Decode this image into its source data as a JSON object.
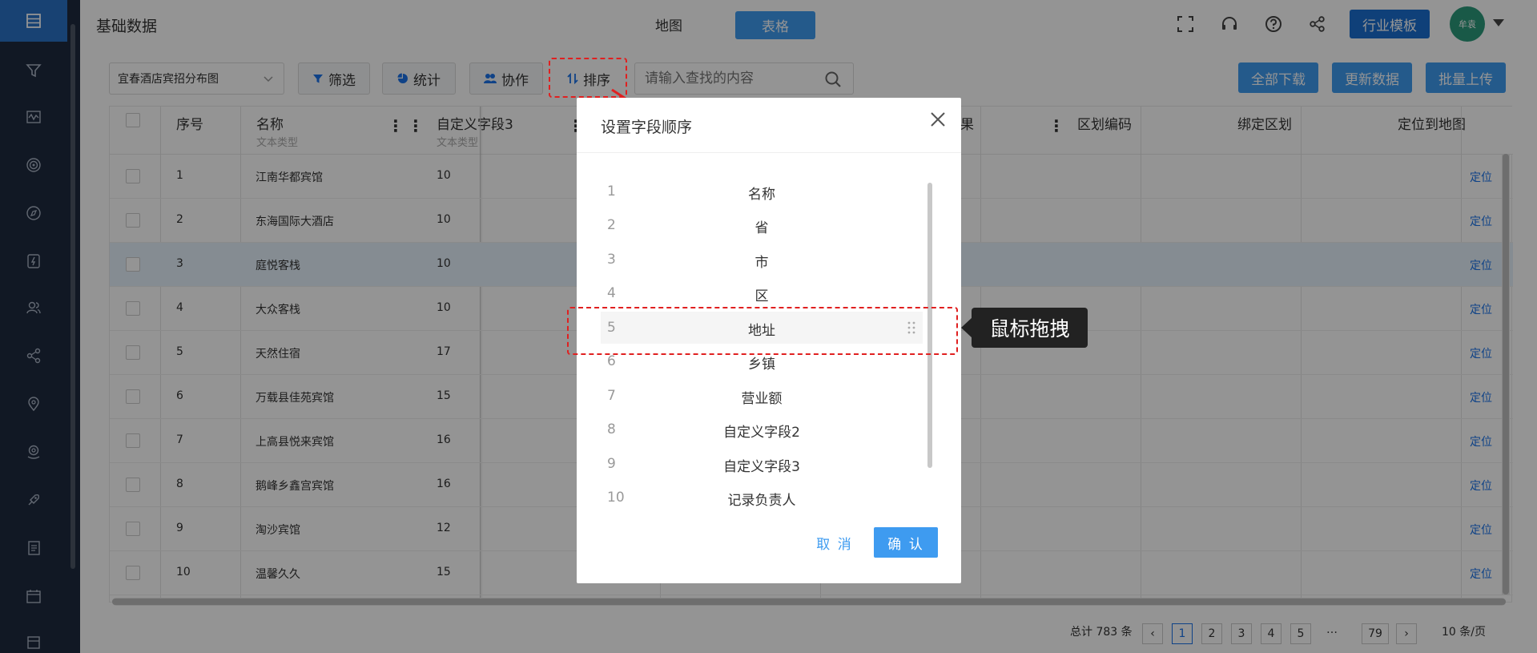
{
  "header": {
    "page_title": "基础数据",
    "view_map": "地图",
    "view_table": "表格",
    "template_button": "行业模板",
    "avatar_text": "牟袁"
  },
  "toolbar": {
    "map_select": "宜春酒店宾招分布图",
    "filter": "筛选",
    "stats": "统计",
    "collab": "协作",
    "sort": "排序",
    "search_placeholder": "请输入查找的内容",
    "download_all": "全部下载",
    "update_data": "更新数据",
    "batch_upload": "批量上传"
  },
  "table": {
    "columns": {
      "index": "序号",
      "name": "名称",
      "name_type": "文本类型",
      "custom3": "自定义字段3",
      "custom3_type": "文本类型",
      "result_partial": "果",
      "region_code": "区划编码",
      "bind_region": "绑定区划",
      "locate_map": "定位到地图"
    },
    "locate_label": "定位",
    "rows": [
      {
        "index": "1",
        "name": "江南华都宾馆",
        "custom3": "10"
      },
      {
        "index": "2",
        "name": "东海国际大酒店",
        "custom3": "10"
      },
      {
        "index": "3",
        "name": "庭悦客栈",
        "custom3": "10"
      },
      {
        "index": "4",
        "name": "大众客栈",
        "custom3": "10"
      },
      {
        "index": "5",
        "name": "天然住宿",
        "custom3": "17"
      },
      {
        "index": "6",
        "name": "万载县佳苑宾馆",
        "custom3": "15"
      },
      {
        "index": "7",
        "name": "上高县悦来宾馆",
        "custom3": "16"
      },
      {
        "index": "8",
        "name": "鹅峰乡鑫宫宾馆",
        "custom3": "16"
      },
      {
        "index": "9",
        "name": "淘沙宾馆",
        "custom3": "12"
      },
      {
        "index": "10",
        "name": "温馨久久",
        "custom3": "15"
      }
    ]
  },
  "pagination": {
    "total": "总计 783 条",
    "pages": [
      "1",
      "2",
      "3",
      "4",
      "5"
    ],
    "ellipsis": "…",
    "last": "79",
    "page_size": "10 条/页"
  },
  "modal": {
    "title": "设置字段顺序",
    "fields": [
      {
        "num": "1",
        "name": "名称"
      },
      {
        "num": "2",
        "name": "省"
      },
      {
        "num": "3",
        "name": "市"
      },
      {
        "num": "4",
        "name": "区"
      },
      {
        "num": "5",
        "name": "地址"
      },
      {
        "num": "6",
        "name": "乡镇"
      },
      {
        "num": "7",
        "name": "营业额"
      },
      {
        "num": "8",
        "name": "自定义字段2"
      },
      {
        "num": "9",
        "name": "自定义字段3"
      },
      {
        "num": "10",
        "name": "记录负责人"
      }
    ],
    "cancel": "取 消",
    "confirm": "确 认"
  },
  "annotation": {
    "tooltip": "鼠标拖拽"
  },
  "colors": {
    "primary": "#3e9bf0",
    "sidebar": "#1e2a3e",
    "highlight": "#e02020"
  }
}
